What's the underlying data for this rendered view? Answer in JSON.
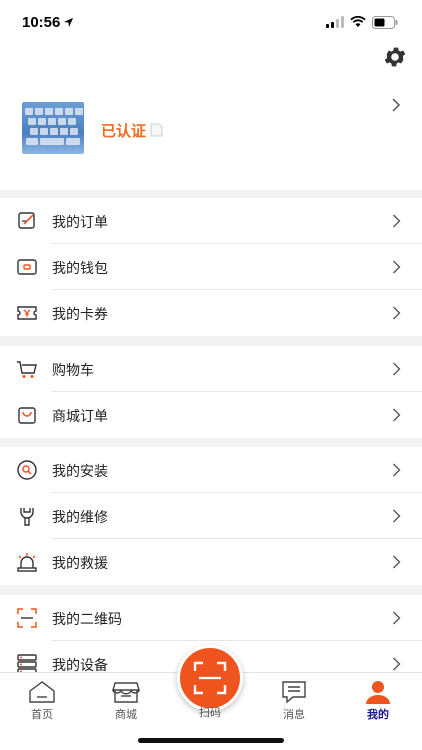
{
  "status_bar": {
    "time": "10:56"
  },
  "profile": {
    "verified_text": "已认证"
  },
  "menu_sections": [
    [
      {
        "label": "我的订单",
        "icon": "order-edit-icon"
      },
      {
        "label": "我的钱包",
        "icon": "wallet-icon"
      },
      {
        "label": "我的卡券",
        "icon": "coupon-icon"
      }
    ],
    [
      {
        "label": "购物车",
        "icon": "cart-icon"
      },
      {
        "label": "商城订单",
        "icon": "shopping-bag-icon"
      }
    ],
    [
      {
        "label": "我的安装",
        "icon": "install-icon"
      },
      {
        "label": "我的维修",
        "icon": "wrench-icon"
      },
      {
        "label": "我的救援",
        "icon": "rescue-siren-icon"
      }
    ],
    [
      {
        "label": "我的二维码",
        "icon": "qr-frame-icon"
      },
      {
        "label": "我的设备",
        "icon": "device-icon"
      }
    ]
  ],
  "tabbar": {
    "tabs": [
      {
        "label": "首页",
        "icon": "home-icon",
        "active": false
      },
      {
        "label": "商城",
        "icon": "store-icon",
        "active": false
      },
      {
        "label": "扫码",
        "icon": "scan-icon",
        "active": false
      },
      {
        "label": "消息",
        "icon": "message-icon",
        "active": false
      },
      {
        "label": "我的",
        "icon": "user-icon",
        "active": true
      }
    ]
  },
  "colors": {
    "accent": "#f0541e",
    "verified": "#f06a23",
    "active_tab": "#1a1a8c"
  }
}
